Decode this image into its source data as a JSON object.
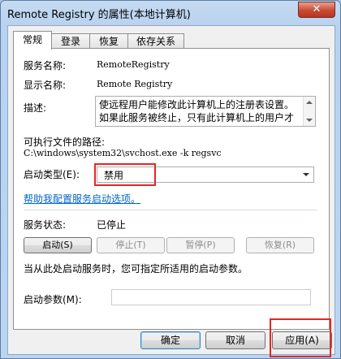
{
  "window": {
    "title": "Remote Registry 的属性(本地计算机)",
    "close_glyph": "✕"
  },
  "tabs": [
    {
      "label": "常规",
      "active": true
    },
    {
      "label": "登录",
      "active": false
    },
    {
      "label": "恢复",
      "active": false
    },
    {
      "label": "依存关系",
      "active": false
    }
  ],
  "general": {
    "service_name_label": "服务名称:",
    "service_name": "RemoteRegistry",
    "display_name_label": "显示名称:",
    "display_name": "Remote Registry",
    "description_label": "描述:",
    "description": "使远程用户能修改此计算机上的注册表设置。如果此服务被终止，只有此计算机上的用户才",
    "exe_path_label": "可执行文件的路径:",
    "exe_path": "C:\\windows\\system32\\svchost.exe -k regsvc",
    "startup_type_label": "启动类型(E):",
    "startup_type_value": "禁用",
    "help_link": "帮助我配置服务启动选项。",
    "status_label": "服务状态:",
    "status_value": "已停止",
    "buttons": {
      "start": "启动(S)",
      "stop": "停止(T)",
      "pause": "暂停(P)",
      "resume": "恢复(R)"
    },
    "hint": "当从此处启动服务时，您可指定所适用的启动参数。",
    "start_params_label": "启动参数(M):",
    "start_params_value": ""
  },
  "footer": {
    "ok": "确定",
    "cancel": "取消",
    "apply": "应用(A)"
  },
  "colors": {
    "highlight": "#e02828",
    "link": "#0066cc",
    "title_bar": "#bcd5ef",
    "close_button": "#c94a35"
  }
}
